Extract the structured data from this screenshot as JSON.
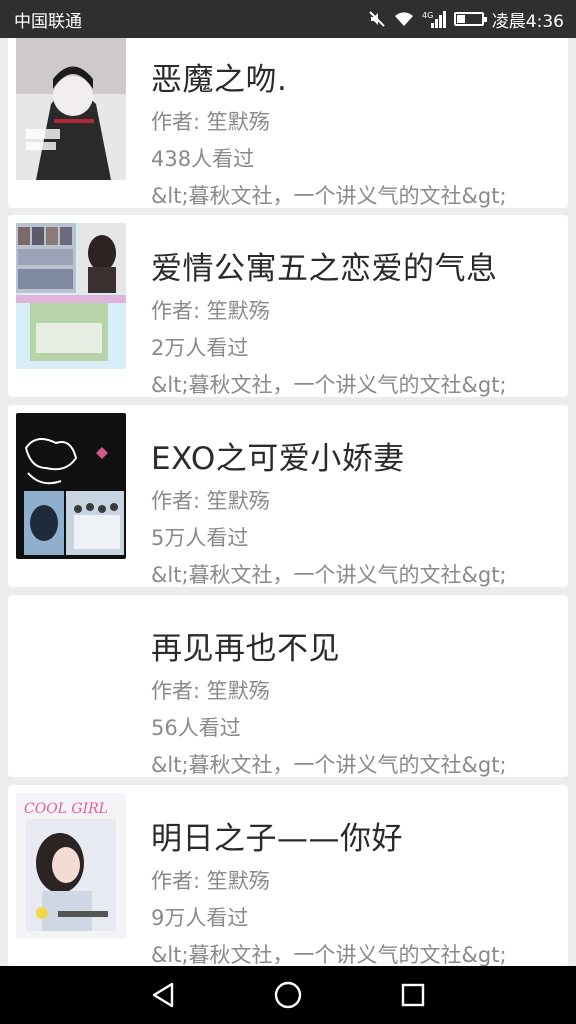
{
  "status_bar": {
    "carrier": "中国联通",
    "time": "凌晨4:36",
    "network": "4G",
    "battery_level": 0.35
  },
  "books": [
    {
      "title": "恶魔之吻.",
      "author": "作者: 笙默殇",
      "views": "438人看过",
      "description": "&lt;暮秋文社，一个讲义气的文社&gt;",
      "cover": "dark-illustration"
    },
    {
      "title": "爱情公寓五之恋爱的气息",
      "author": "作者: 笙默殇",
      "views": "2万人看过",
      "description": "&lt;暮秋文社，一个讲义气的文社&gt;",
      "cover": "group-collage"
    },
    {
      "title": "EXO之可爱小娇妻",
      "author": "作者: 笙默殇",
      "views": "5万人看过",
      "description": "&lt;暮秋文社，一个讲义气的文社&gt;",
      "cover": "love-you-dark"
    },
    {
      "title": "再见再也不见",
      "author": "作者: 笙默殇",
      "views": "56人看过",
      "description": "&lt;暮秋文社，一个讲义气的文社&gt;",
      "cover": "blank"
    },
    {
      "title": "明日之子——你好",
      "author": "作者: 笙默殇",
      "views": "9万人看过",
      "description": "&lt;暮秋文社，一个讲义气的文社&gt;",
      "cover": "cool-girl"
    }
  ],
  "nav_bar": {
    "back": "back-triangle-icon",
    "home": "home-circle-icon",
    "recents": "recents-square-icon"
  }
}
